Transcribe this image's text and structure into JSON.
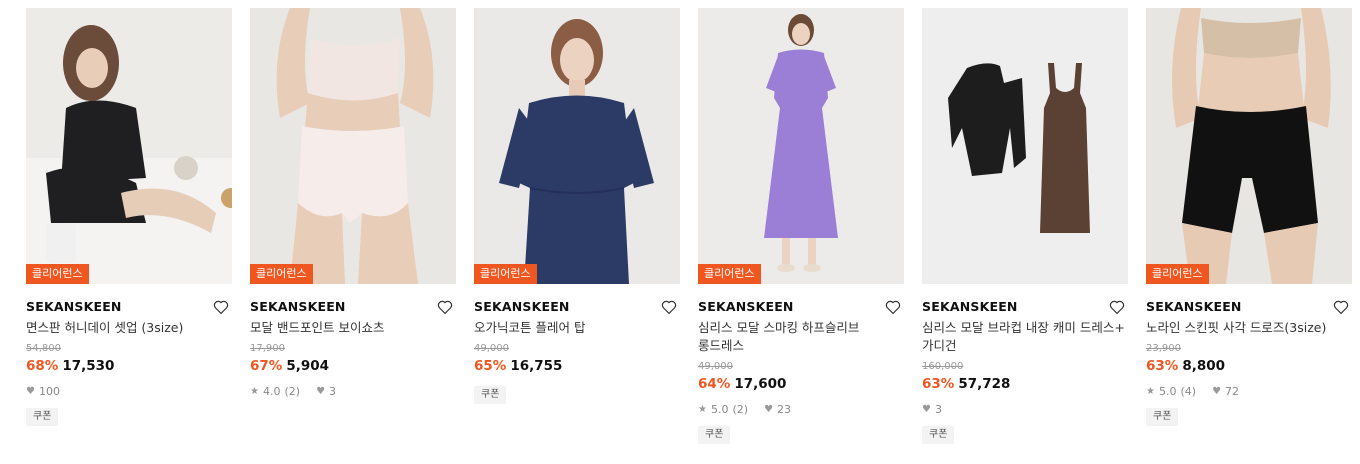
{
  "products": [
    {
      "badge": "클리어런스",
      "brand": "SEKANSKEEN",
      "name": "면스판 허니데이 셋업 (3size)",
      "original_price": "54,800",
      "discount": "68%",
      "price": "17,530",
      "likes": "100",
      "coupon": "쿠폰"
    },
    {
      "badge": "클리어런스",
      "brand": "SEKANSKEEN",
      "name": "모달 밴드포인트 보이쇼츠",
      "original_price": "17,900",
      "discount": "67%",
      "price": "5,904",
      "rating": "4.0",
      "reviews": "(2)",
      "likes": "3"
    },
    {
      "badge": "클리어런스",
      "brand": "SEKANSKEEN",
      "name": "오가닉코튼 플레어 탑",
      "original_price": "49,000",
      "discount": "65%",
      "price": "16,755",
      "coupon": "쿠폰"
    },
    {
      "badge": "클리어런스",
      "brand": "SEKANSKEEN",
      "name_line1": "심리스 모달 스마킹 하프슬리브",
      "name_line2": "롱드레스",
      "original_price": "49,000",
      "discount": "64%",
      "price": "17,600",
      "rating": "5.0",
      "reviews": "(2)",
      "likes": "23",
      "coupon": "쿠폰"
    },
    {
      "brand": "SEKANSKEEN",
      "name_line1": "심리스 모달 브라컵 내장 캐미 드레스+",
      "name_line2": "가디건",
      "original_price": "160,000",
      "discount": "63%",
      "price": "57,728",
      "likes": "3",
      "coupon": "쿠폰"
    },
    {
      "badge": "클리어런스",
      "brand": "SEKANSKEEN",
      "name": "노라인 스킨핏 사각 드로즈(3size)",
      "original_price": "23,900",
      "discount": "63%",
      "price": "8,800",
      "rating": "5.0",
      "reviews": "(4)",
      "likes": "72",
      "coupon": "쿠폰"
    }
  ],
  "colors": {
    "accent": "#f0561f",
    "heart": "#999999",
    "badge_text": "#ffffff"
  },
  "icons": {
    "wishlist": "heart-outline-icon",
    "likes": "heart-filled-icon",
    "rating": "star-icon"
  }
}
